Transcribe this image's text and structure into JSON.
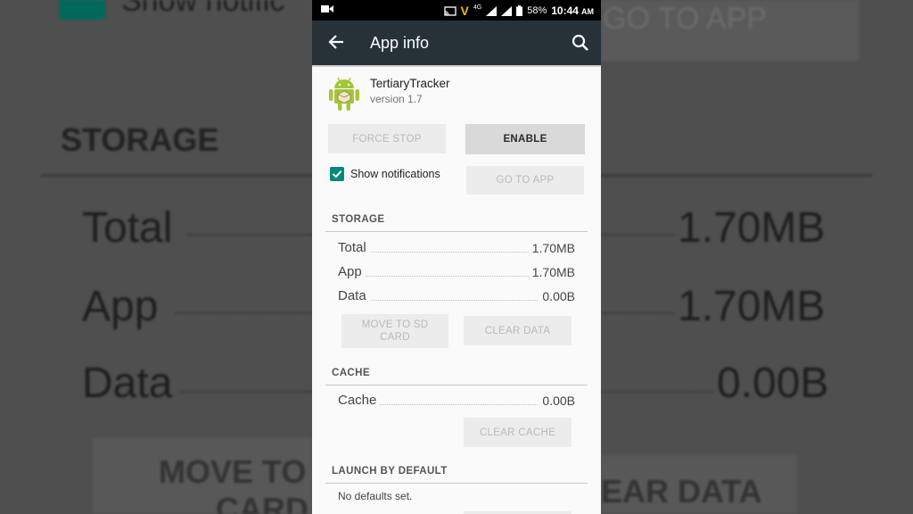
{
  "status_bar": {
    "battery": "58%",
    "time": "10:44",
    "ampm": "AM",
    "network": "4G",
    "carrier_logo": "V",
    "icons": [
      "video-icon",
      "cast-icon",
      "carrier-logo",
      "signal-icon",
      "signal-icon",
      "battery-icon"
    ]
  },
  "app_bar": {
    "title": "App info",
    "back_icon": "back-arrow-icon",
    "search_icon": "search-icon"
  },
  "app": {
    "name": "TertiaryTracker",
    "version": "version 1.7",
    "icon": "android-icon"
  },
  "buttons": {
    "force_stop": "FORCE STOP",
    "enable": "ENABLE",
    "go_to_app": "GO TO APP"
  },
  "notifications": {
    "label": "Show notifications",
    "checked": true
  },
  "storage": {
    "header": "STORAGE",
    "rows": [
      {
        "label": "Total",
        "value": "1.70MB"
      },
      {
        "label": "App",
        "value": "1.70MB"
      },
      {
        "label": "Data",
        "value": "0.00B"
      }
    ],
    "move_to_sd": "MOVE TO SD CARD",
    "clear_data": "CLEAR DATA"
  },
  "cache": {
    "header": "CACHE",
    "rows": [
      {
        "label": "Cache",
        "value": "0.00B"
      }
    ],
    "clear_cache": "CLEAR CACHE"
  },
  "launch": {
    "header": "LAUNCH BY DEFAULT",
    "text": "No defaults set."
  },
  "background": {
    "notif_partial": "Show notific",
    "go_to_app_partial": "GO TO APP",
    "storage": "STORAGE",
    "total": "Total",
    "total_val": "1.70MB",
    "app": "App",
    "app_val": "1.70MB",
    "data": "Data",
    "data_val": "0.00B",
    "move_partial": "MOVE TO",
    "card_partial": "CARD",
    "clear_partial": "EAR DATA"
  },
  "colors": {
    "app_bar": "#263238",
    "accent": "#00897b",
    "android_green": "#a4c639"
  }
}
